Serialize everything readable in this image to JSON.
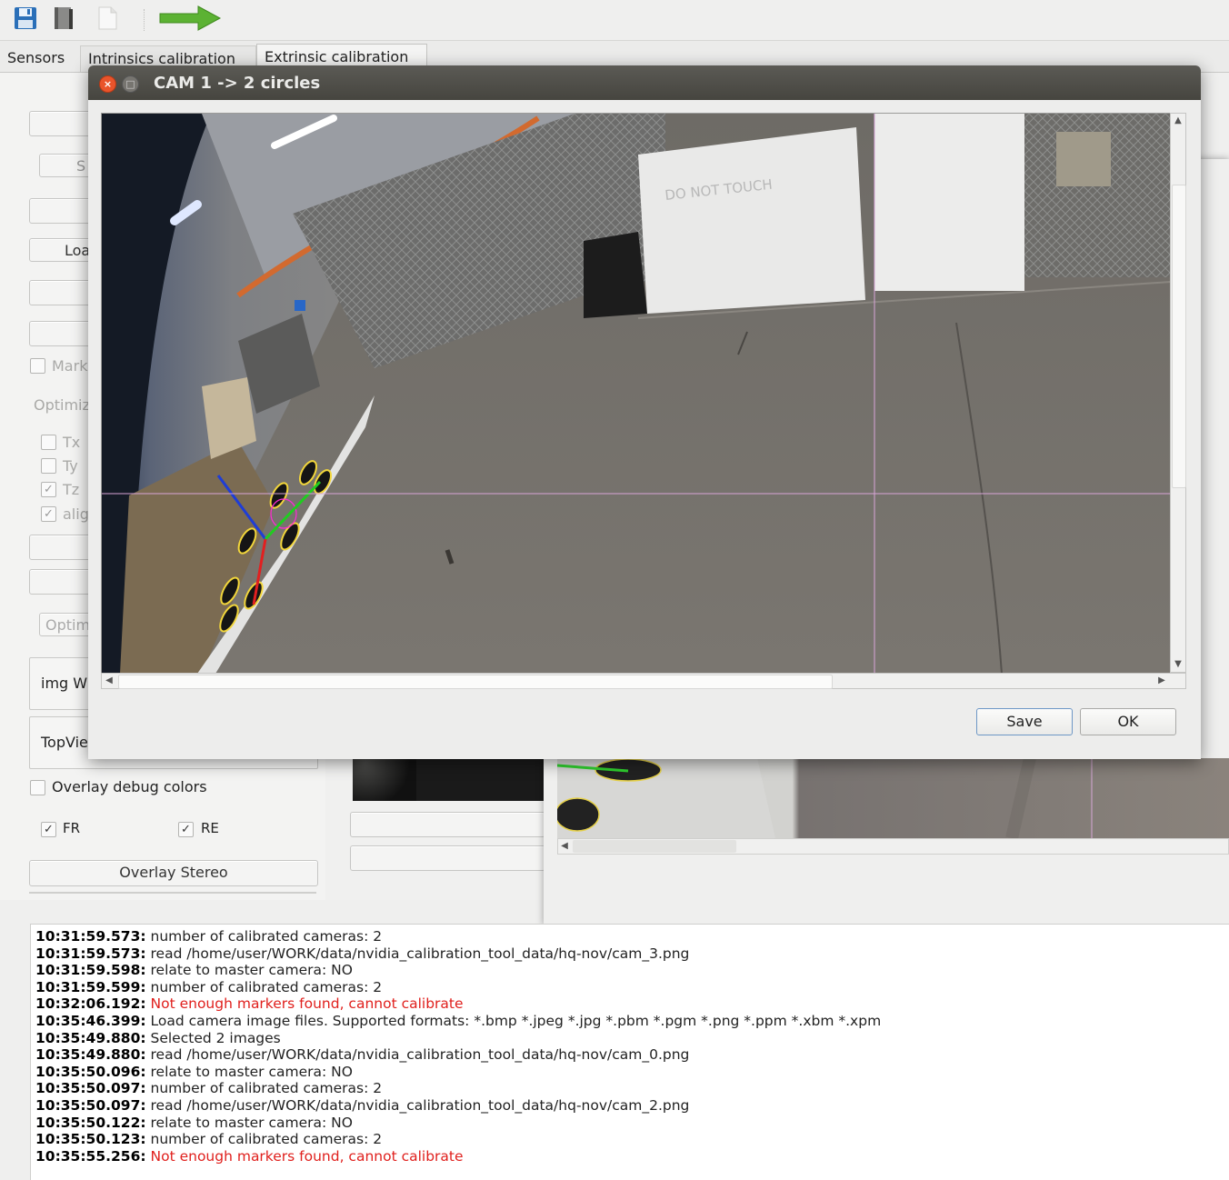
{
  "toolbar": {
    "icons": [
      "save-icon",
      "book-icon",
      "new-document-icon",
      "green-arrow-icon"
    ]
  },
  "tabs": [
    {
      "label": "Sensors"
    },
    {
      "label": "Intrinsics calibration"
    },
    {
      "label": "Extrinsic calibration"
    }
  ],
  "left_panel": {
    "btn_s_fragment": "S",
    "btn_load_fragment": "Loa",
    "marker_label_fragment": "Mark",
    "optimize_label_fragment": "Optimiz",
    "checks": [
      {
        "label": "Tx",
        "checked": false
      },
      {
        "label": "Ty",
        "checked": false
      },
      {
        "label": "Tz",
        "checked": true
      },
      {
        "label": "alig",
        "checked": true
      }
    ],
    "optim_input_fragment": "Optim",
    "img_group_fragment": "img W",
    "topview_group_fragment": "TopVie",
    "overlay_debug_label": "Overlay debug colors",
    "fr_label": "FR",
    "re_label": "RE",
    "overlay_stereo_label": "Overlay Stereo"
  },
  "dialog": {
    "title": "CAM 1 -> 2 circles",
    "sign_text": "DO NOT TOUCH",
    "save_label": "Save",
    "ok_label": "OK"
  },
  "log": {
    "lines": [
      {
        "ts": "10:31:59.573:",
        "msg": "number of calibrated cameras: 2",
        "error": false
      },
      {
        "ts": "10:31:59.573:",
        "msg": "read /home/user/WORK/data/nvidia_calibration_tool_data/hq-nov/cam_3.png",
        "error": false
      },
      {
        "ts": "10:31:59.598:",
        "msg": "relate to master camera: NO",
        "error": false
      },
      {
        "ts": "10:31:59.599:",
        "msg": "number of calibrated cameras: 2",
        "error": false
      },
      {
        "ts": "10:32:06.192:",
        "msg": "Not enough markers found, cannot calibrate",
        "error": true
      },
      {
        "ts": "10:35:46.399:",
        "msg": "Load camera image files. Supported formats: *.bmp *.jpeg *.jpg *.pbm *.pgm *.png *.ppm *.xbm *.xpm",
        "error": false
      },
      {
        "ts": "10:35:49.880:",
        "msg": "Selected 2 images",
        "error": false
      },
      {
        "ts": "10:35:49.880:",
        "msg": "read /home/user/WORK/data/nvidia_calibration_tool_data/hq-nov/cam_0.png",
        "error": false
      },
      {
        "ts": "10:35:50.096:",
        "msg": "relate to master camera: NO",
        "error": false
      },
      {
        "ts": "10:35:50.097:",
        "msg": "number of calibrated cameras: 2",
        "error": false
      },
      {
        "ts": "10:35:50.097:",
        "msg": "read /home/user/WORK/data/nvidia_calibration_tool_data/hq-nov/cam_2.png",
        "error": false
      },
      {
        "ts": "10:35:50.122:",
        "msg": "relate to master camera: NO",
        "error": false
      },
      {
        "ts": "10:35:50.123:",
        "msg": "number of calibrated cameras: 2",
        "error": false
      },
      {
        "ts": "10:35:55.256:",
        "msg": "Not enough markers found, cannot calibrate",
        "error": true
      }
    ]
  }
}
